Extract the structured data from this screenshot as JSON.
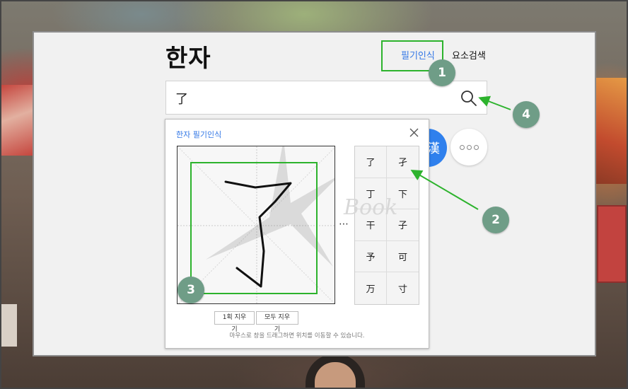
{
  "page": {
    "title": "한자"
  },
  "tabs": {
    "handwriting": "필기인식",
    "element_search": "요소검색"
  },
  "search": {
    "value": "了",
    "icon": "search-icon"
  },
  "circle_buttons": {
    "blue_label": "漢",
    "more_icon": "more-dots-icon"
  },
  "popup": {
    "title": "한자 필기인식",
    "close_icon": "close-icon",
    "more_indicator": "⋯",
    "candidates": [
      "了",
      "孑",
      "丁",
      "下",
      "干",
      "子",
      "予",
      "可",
      "万",
      "寸"
    ],
    "buttons": {
      "clear_stroke": "1획 지우기",
      "clear_all": "모두 지우기"
    },
    "hint": "마우스로 창을 드래그하면 위치를 이동할 수 있습니다."
  },
  "watermark": {
    "text": "Book"
  },
  "annotations": {
    "badges": [
      "1",
      "2",
      "3",
      "4"
    ]
  },
  "colors": {
    "accent_blue": "#3478e6",
    "highlight_green": "#2db32d",
    "badge_green": "#6f9d87"
  }
}
